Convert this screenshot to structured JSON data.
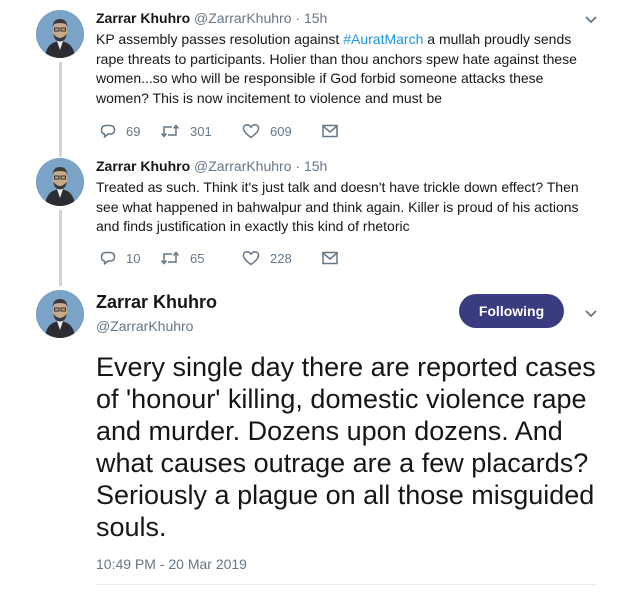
{
  "thread": [
    {
      "name": "Zarrar Khuhro",
      "handle": "@ZarrarKhuhro",
      "time": "15h",
      "text_pre": "KP assembly passes resolution against ",
      "hashtag": "#AuratMarch",
      "text_post": " a mullah proudly sends rape threats to participants. Holier than thou anchors spew hate against these women...so who will be responsible if God forbid someone attacks these women? This is now incitement to violence and must be",
      "replies": "69",
      "retweets": "301",
      "likes": "609"
    },
    {
      "name": "Zarrar Khuhro",
      "handle": "@ZarrarKhuhro",
      "time": "15h",
      "text": "Treated as such. Think it's just talk and doesn't have trickle down effect? Then see what happened in bahwalpur and think again. Killer is proud of his actions and finds justification in exactly this kind of rhetoric",
      "replies": "10",
      "retweets": "65",
      "likes": "228"
    }
  ],
  "main_tweet": {
    "name": "Zarrar Khuhro",
    "handle": "@ZarrarKhuhro",
    "follow_label": "Following",
    "text": "Every single day there are reported cases of 'honour' killing, domestic violence rape and murder. Dozens upon dozens. And what causes outrage are a few placards? Seriously a plague on all those misguided souls.",
    "timestamp": "10:49 PM - 20 Mar 2019"
  },
  "separator": "·",
  "icons": {
    "reply": "reply-icon",
    "retweet": "retweet-icon",
    "like": "heart-icon",
    "dm": "envelope-icon",
    "more": "chevron-down-icon"
  },
  "colors": {
    "follow_button": "#3b3c7f",
    "hashtag": "#1b95e0",
    "muted": "#657786",
    "avatar_bg": "#7ba3c7"
  }
}
